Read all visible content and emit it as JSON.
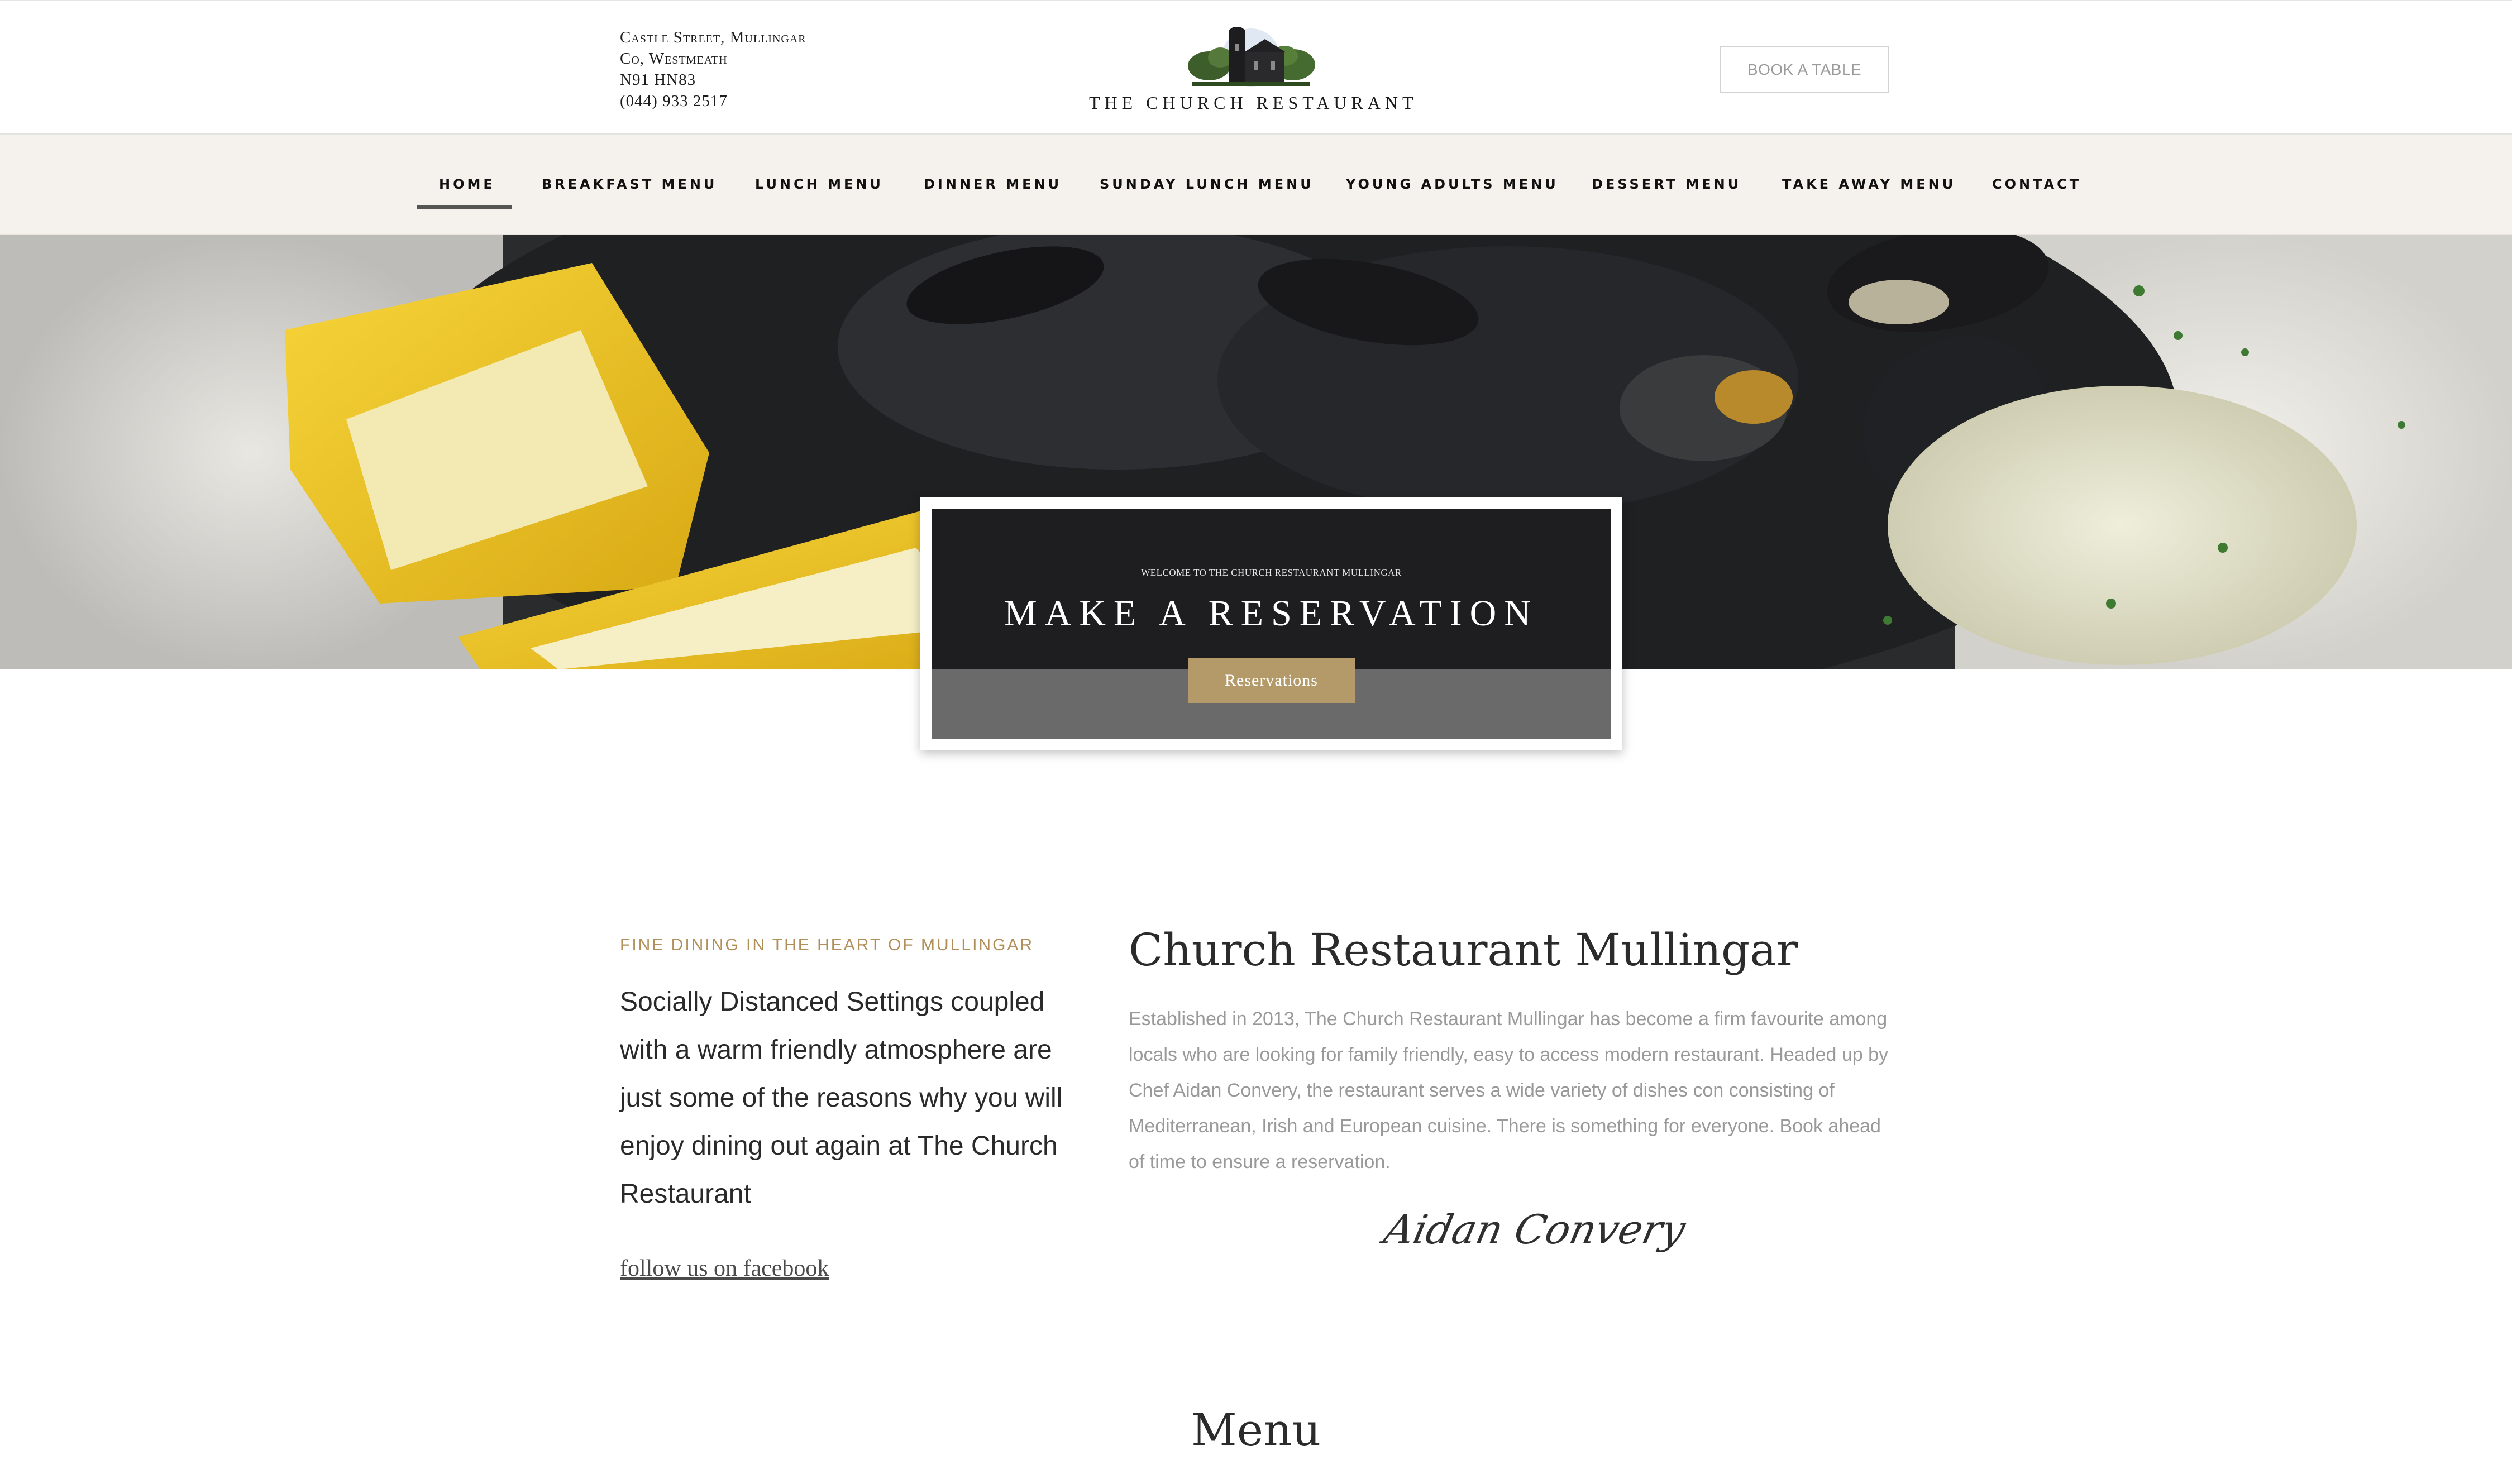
{
  "header": {
    "address_lines": [
      "Castle Street, Mullingar",
      "Co, Westmeath",
      "N91 HN83",
      "(044) 933 2517"
    ],
    "logo_text": "THE CHURCH RESTAURANT",
    "book_label": "BOOK A TABLE"
  },
  "nav": {
    "items": [
      {
        "label": "HOME",
        "active": true
      },
      {
        "label": "BREAKFAST MENU"
      },
      {
        "label": "LUNCH MENU"
      },
      {
        "label": "DINNER MENU"
      },
      {
        "label": "SUNDAY LUNCH MENU"
      },
      {
        "label": "YOUNG ADULTS MENU"
      },
      {
        "label": "DESSERT MENU"
      },
      {
        "label": "TAKE AWAY MENU"
      },
      {
        "label": "CONTACT"
      }
    ]
  },
  "hero": {
    "eyebrow": "WELCOME TO THE CHURCH RESTAURANT MULLINGAR",
    "title": "Make a reservation",
    "button": "Reservations"
  },
  "intro": {
    "eyebrow": "FINE DINING IN THE HEART OF MULLINGAR",
    "lead": "Socially Distanced Settings coupled with a warm friendly atmosphere are just some of the reasons why you will enjoy dining out again at The Church Restaurant",
    "facebook_link": "follow us on facebook",
    "title": "Church Restaurant Mullingar",
    "body": "Established in 2013, The Church Restaurant Mullingar has become a firm favourite among locals who are looking for family friendly, easy to access modern restaurant. Headed up by Chef Aidan Convery, the restaurant serves a wide variety of dishes con consisting of Mediterranean, Irish and European cuisine. There is something for everyone. Book ahead of time to ensure a reservation.",
    "signature": "Aidan Convery"
  },
  "menu_section": {
    "title": "Menu"
  },
  "colors": {
    "accent_gold": "#b08f58",
    "button_gold": "#b39a68",
    "nav_bg": "#f5f2ed"
  }
}
